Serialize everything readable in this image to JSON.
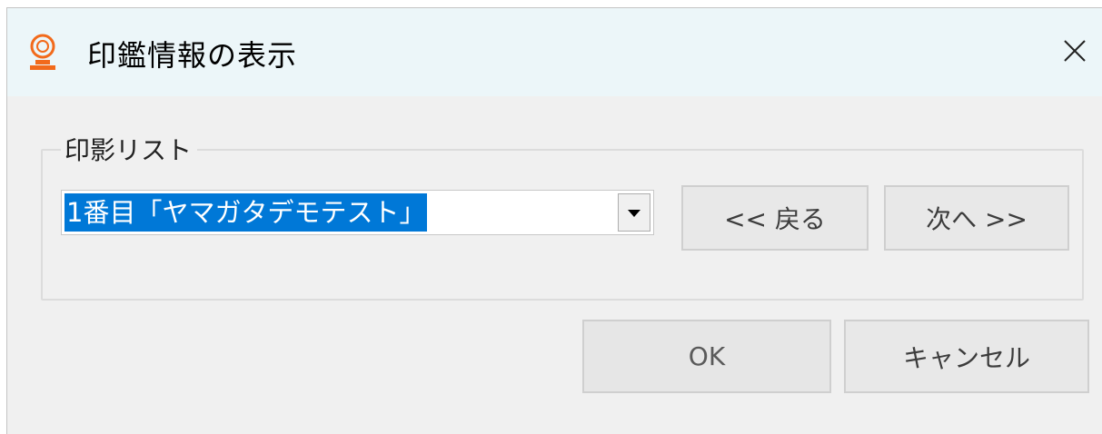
{
  "window": {
    "title": "印鑑情報の表示",
    "close_symbol": "×"
  },
  "icons": {
    "app": "seal-stamp-icon",
    "close": "close-icon",
    "dropdown": "dropdown-arrow-icon"
  },
  "group": {
    "label": "印影リスト",
    "combo": {
      "selected_value": "1番目「ヤマガタデモテスト」"
    },
    "prev_button": "<< 戻る",
    "next_button": "次へ >>"
  },
  "footer": {
    "ok_button": "OK",
    "cancel_button": "キャンセル"
  },
  "colors": {
    "titlebar": "#ecf6f9",
    "dialog_bg": "#f0f0f0",
    "selection": "#0078d7",
    "icon_accent": "#f26a1b"
  }
}
